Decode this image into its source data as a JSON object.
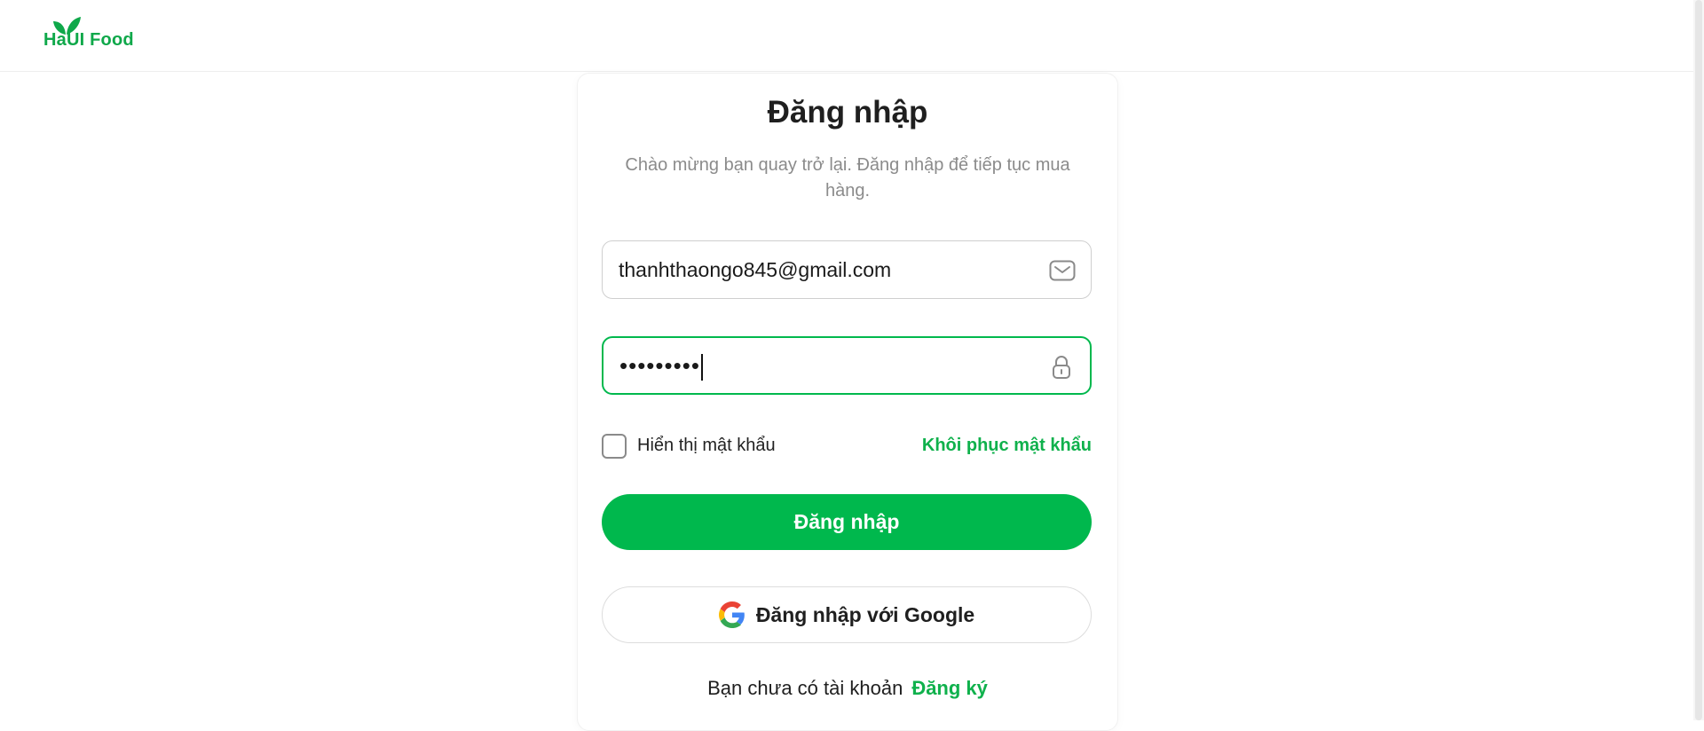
{
  "brand": {
    "name": "HaUI Food",
    "color": "#0fa84a"
  },
  "login": {
    "title": "Đăng nhập",
    "subtitle": "Chào mừng bạn quay trở lại. Đăng nhập để tiếp tục mua hàng.",
    "email": {
      "value": "thanhthaongo845@gmail.com",
      "icon": "mail-icon"
    },
    "password": {
      "masked_value": "•••••••••",
      "icon": "lock-icon"
    },
    "show_password_label": "Hiển thị mật khẩu",
    "show_password_checked": false,
    "forgot_password_label": "Khôi phục mật khẩu",
    "submit_label": "Đăng nhập",
    "google_label": "Đăng nhập với Google",
    "no_account_text": "Bạn chưa có tài khoản",
    "signup_label": "Đăng ký"
  },
  "colors": {
    "accent": "#00b84d",
    "focus_border": "#00b84d",
    "muted_text": "#8b8b8b"
  }
}
